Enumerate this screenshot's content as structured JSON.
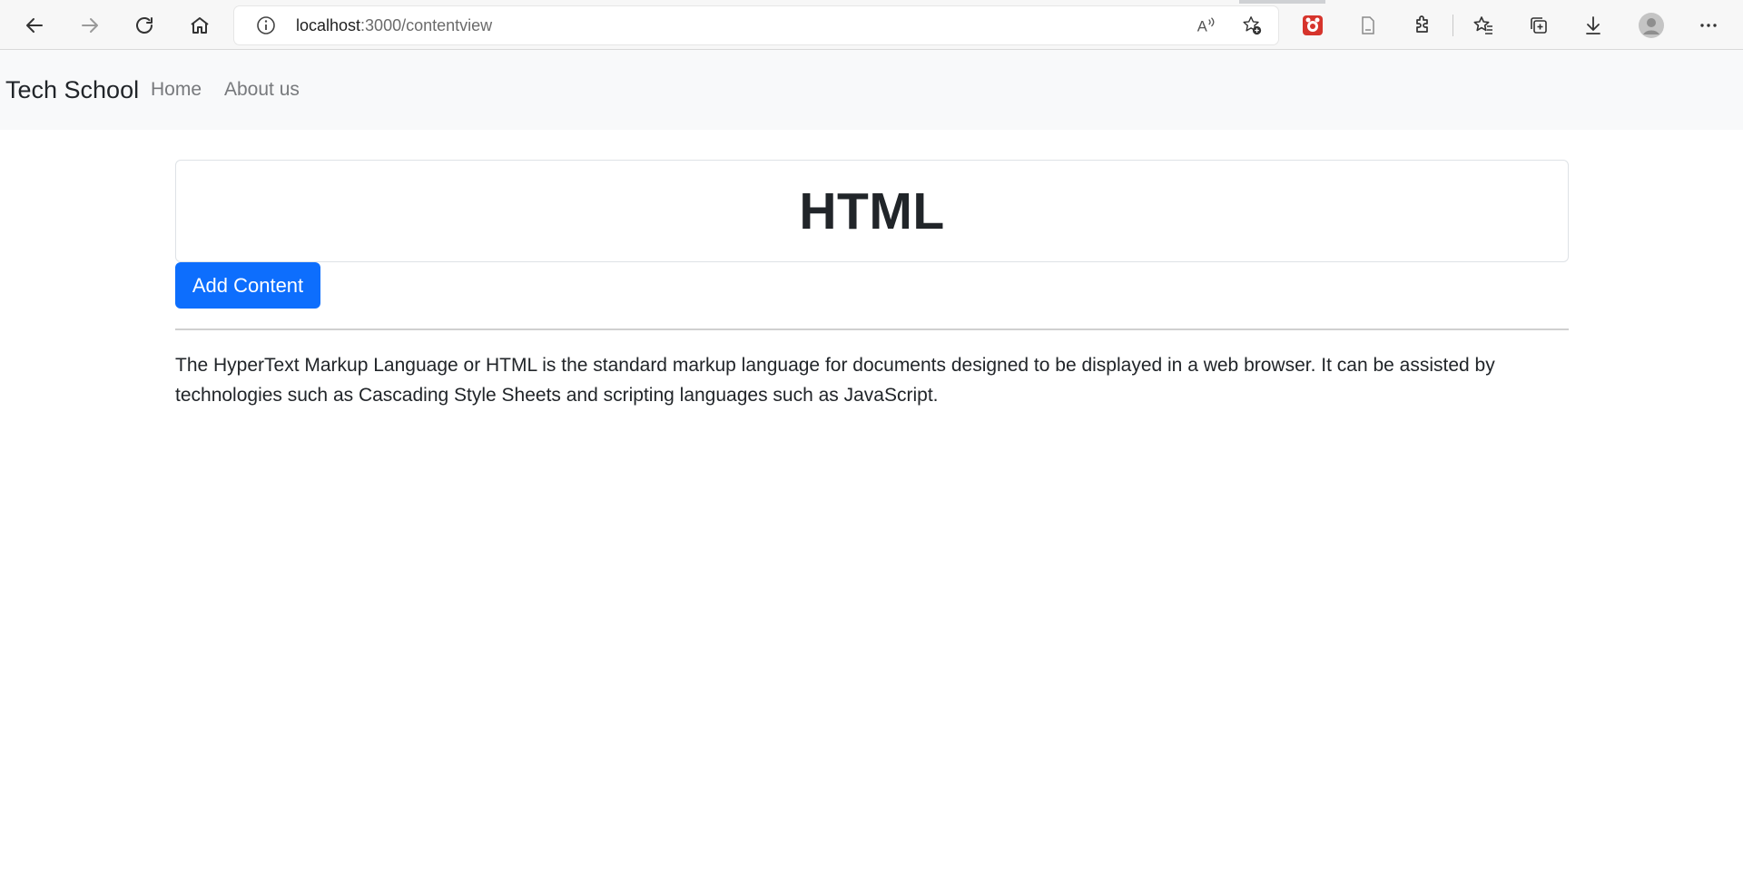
{
  "browser": {
    "url_host": "localhost",
    "url_path": ":3000/contentview",
    "icons": {
      "back": "back-arrow-icon",
      "forward": "forward-arrow-icon",
      "refresh": "refresh-icon",
      "home": "home-icon",
      "site_info": "info-icon",
      "read_aloud": "read-aloud-icon",
      "add_favorite": "add-favorite-icon",
      "extension": "extension-icon",
      "pdf": "document-icon",
      "extensions": "puzzle-icon",
      "favorites": "favorites-icon",
      "collections": "collections-icon",
      "downloads": "download-icon",
      "profile": "profile-avatar-icon",
      "menu": "more-menu-icon"
    }
  },
  "navbar": {
    "brand": "Tech School",
    "links": [
      {
        "label": "Home"
      },
      {
        "label": "About us"
      }
    ]
  },
  "content": {
    "title": "HTML",
    "add_button_label": "Add Content",
    "description": "The HyperText Markup Language or HTML is the standard markup language for documents designed to be displayed in a web browser. It can be assisted by technologies such as Cascading Style Sheets and scripting languages such as JavaScript."
  },
  "colors": {
    "primary_button": "#0d6efd",
    "navbar_bg": "#f8f9fa",
    "nav_link": "#77797c",
    "text": "#212529"
  }
}
